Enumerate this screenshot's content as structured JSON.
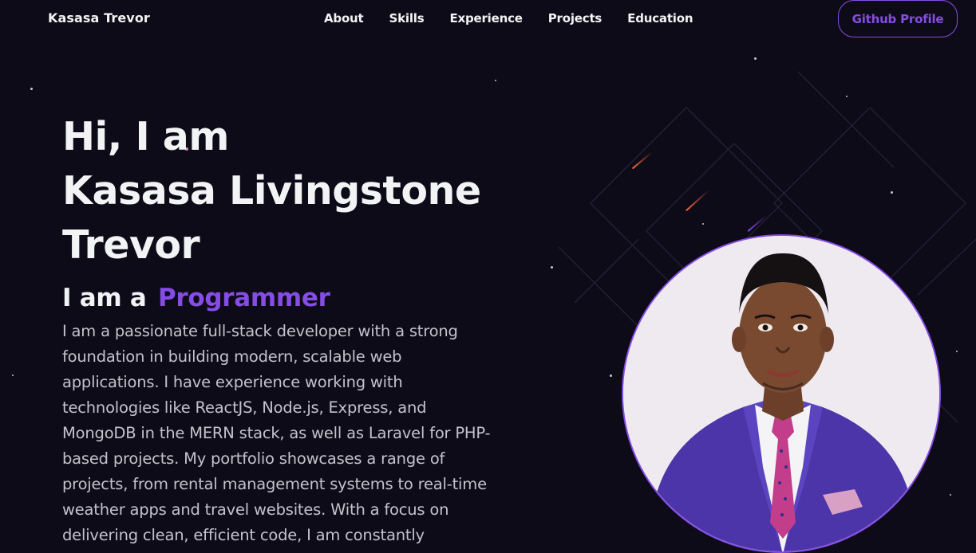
{
  "navbar": {
    "logo": "Kasasa Trevor",
    "links": [
      "About",
      "Skills",
      "Experience",
      "Projects",
      "Education"
    ],
    "github_button": "Github Profile"
  },
  "hero": {
    "greeting_line1": "Hi, I am",
    "greeting_line2": "Kasasa Livingstone",
    "greeting_line3": "Trevor",
    "role_prefix": "I am a",
    "role_value": "Programmer",
    "bio": "I am a passionate full-stack developer with a strong foundation in building modern, scalable web applications. I have experience working with technologies like ReactJS, Node.js, Express, and MongoDB in the MERN stack, as well as Laravel for PHP-based projects. My portfolio showcases a range of projects, from rental management systems to real-time weather apps and travel websites. With a focus on delivering clean, efficient code, I am constantly"
  },
  "colors": {
    "background": "#0e0b18",
    "accent": "#854ce6",
    "text_primary": "#f2f3f4",
    "text_secondary": "#c3c2cc"
  },
  "profile_image": {
    "icon": "profile-photo"
  }
}
